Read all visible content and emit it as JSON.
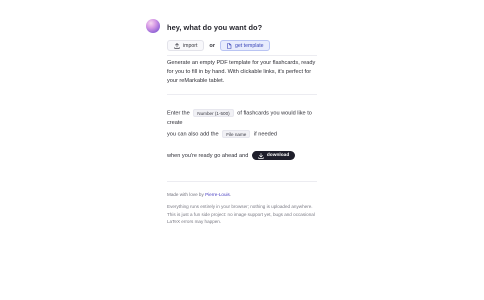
{
  "header": {
    "title": "hey, what do you want do?"
  },
  "actions": {
    "import_label": "import",
    "or_label": "or",
    "template_label": "get template",
    "import_icon": "upload-icon",
    "template_icon": "document-icon"
  },
  "intro": {
    "text": "Generate an empty PDF template for your flashcards, ready for you to fill in by hand. With clickable links, it's perfect for your reMarkable tablet."
  },
  "form": {
    "enter_prefix": "Enter the",
    "number_placeholder": "Number (1-500)",
    "enter_suffix": "of flashcards you would like to create",
    "name_prefix": "you can also add the",
    "name_placeholder": "File name",
    "name_suffix": "if needed",
    "download_prefix": "when you're ready go ahead and",
    "download_label": "download",
    "download_icon": "download-icon"
  },
  "footer": {
    "made_prefix": "Made with love by",
    "author": "Pierre-Louis",
    "made_suffix": ".",
    "note": "Everything runs entirely in your browser; nothing is uploaded anywhere. This is just a fun side project: no image support yet, bugs and occasional LaTeX errors may happen."
  },
  "colors": {
    "accent": "#3b46b8",
    "download_bg": "#1f1f2b",
    "avatar": "#9a6bd8"
  }
}
